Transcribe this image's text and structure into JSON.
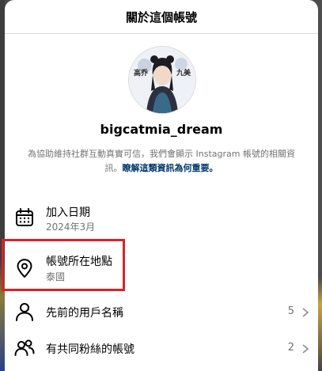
{
  "header": {
    "title": "關於這個帳號"
  },
  "profile": {
    "username": "bigcatmia_dream",
    "avatar_alt": "avatar",
    "avatar_text_left": "高乔",
    "avatar_text_right": "九美"
  },
  "description": {
    "text": "為協助維持社群互動真實可信，我們會顯示 Instagram 帳號的相關資訊。",
    "link": "瞭解這類資訊為何重要。"
  },
  "rows": [
    {
      "icon": "calendar-icon",
      "title": "加入日期",
      "subtitle": "2024年3月"
    },
    {
      "icon": "location-pin-icon",
      "title": "帳號所在地點",
      "subtitle": "泰國"
    },
    {
      "icon": "person-icon",
      "title": "先前的用戶名稱",
      "count": "5"
    },
    {
      "icon": "people-icon",
      "title": "有共同粉絲的帳號",
      "count": "2"
    }
  ],
  "colors": {
    "highlight": "#d9222a",
    "link": "#00376b",
    "secondary_text": "#737373"
  }
}
